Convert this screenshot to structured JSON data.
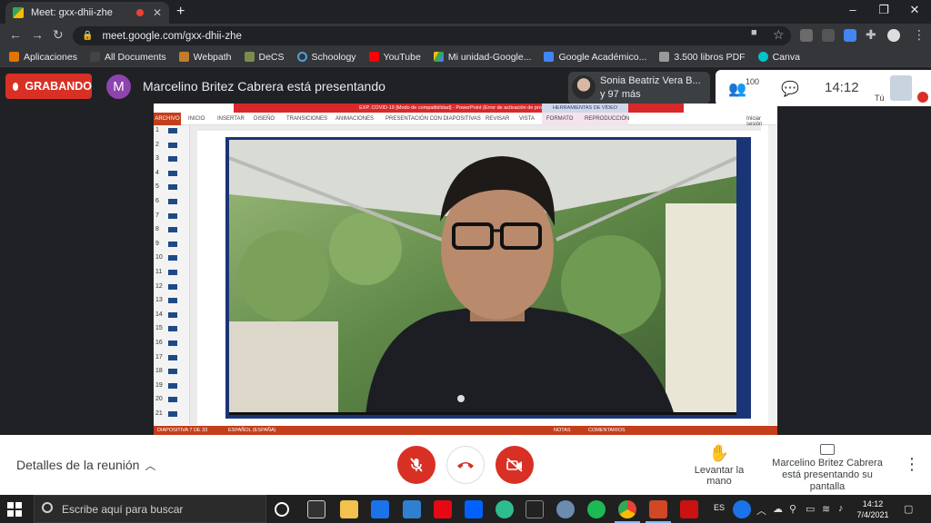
{
  "browser": {
    "tab_title": "Meet: gxx-dhii-zhe",
    "url": "meet.google.com/gxx-dhii-zhe",
    "bookmarks": [
      "Aplicaciones",
      "All Documents",
      "Webpath",
      "DeCS",
      "Schoology",
      "YouTube",
      "Mi unidad-Google...",
      "Google Académico...",
      "3.500 libros PDF",
      "Canva"
    ]
  },
  "meet": {
    "recording_label": "GRABANDO",
    "presenter_initial": "M",
    "presenting_title": "Marcelino Britez Cabrera está presentando",
    "participant_name": "Sonia Beatriz Vera B...",
    "participant_more": "y 97 más",
    "participant_count": "100",
    "clock": "14:12",
    "self_label": "Tú"
  },
  "presentation": {
    "window_title": "EXP. COVID-19 [Modo de compatibilidad] - PowerPoint (Error de activación de productos)",
    "video_tools": "HERRAMIENTAS DE VÍDEO",
    "ribbon_tabs": [
      "ARCHIVO",
      "INICIO",
      "INSERTAR",
      "DISEÑO",
      "TRANSICIONES",
      "ANIMACIONES",
      "PRESENTACIÓN CON DIAPOSITIVAS",
      "REVISAR",
      "VISTA",
      "FORMATO",
      "REPRODUCCIÓN"
    ],
    "signin": "Iniciar sesión",
    "slide_numbers": [
      "1",
      "2",
      "3",
      "4",
      "5",
      "6",
      "7",
      "8",
      "9",
      "10",
      "11",
      "12",
      "13",
      "14",
      "15",
      "16",
      "17",
      "18",
      "19",
      "20",
      "21"
    ],
    "status_slide": "DIAPOSITIVA 7 DE 33",
    "status_lang": "ESPAÑOL (ESPAÑA)",
    "status_notes": "NOTAS",
    "status_comments": "COMENTARIOS"
  },
  "controls": {
    "details": "Detalles de la reunión",
    "raise_hand": "Levantar la mano",
    "presenting_line1": "Marcelino Britez Cabrera",
    "presenting_line2": "está presentando su pantalla"
  },
  "taskbar": {
    "search_placeholder": "Escribe aquí para buscar",
    "lang": "ES",
    "time": "14:12",
    "date": "7/4/2021"
  }
}
